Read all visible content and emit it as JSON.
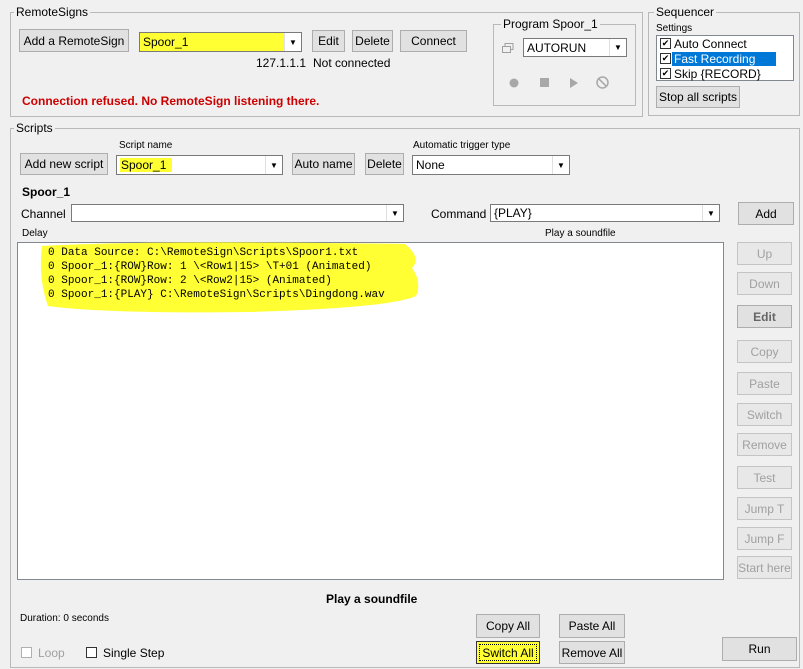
{
  "remote_signs": {
    "group_title": "RemoteSigns",
    "add_button": "Add a RemoteSign",
    "selected_sign": "Spoor_1",
    "edit_button": "Edit",
    "delete_button": "Delete",
    "connect_button": "Connect",
    "address": "127.1.1.1",
    "connection_state": "Not connected",
    "error_message": "Connection refused. No RemoteSign listening there."
  },
  "program": {
    "group_title": "Program Spoor_1",
    "mode": "AUTORUN"
  },
  "sequencer": {
    "group_title": "Sequencer",
    "settings_label": "Settings",
    "options": [
      {
        "label": "Auto Connect",
        "checked": true
      },
      {
        "label": "Fast Recording",
        "checked": true
      },
      {
        "label": "Skip {RECORD}",
        "checked": true
      }
    ],
    "stop_all_button": "Stop all scripts"
  },
  "scripts": {
    "group_title": "Scripts",
    "add_new_button": "Add new script",
    "script_name_label": "Script name",
    "script_name": "Spoor_1",
    "auto_name_button": "Auto name",
    "delete_button": "Delete",
    "trigger_label": "Automatic trigger type",
    "trigger_value": "None",
    "current_script": "Spoor_1",
    "channel_label": "Channel",
    "channel_value": "",
    "command_label": "Command",
    "command_value": "{PLAY}",
    "add_button": "Add",
    "delay_label": "Delay",
    "command_hint": "Play a soundfile",
    "lines": [
      {
        "delay": "0",
        "text": "Data Source: C:\\RemoteSign\\Scripts\\Spoor1.txt"
      },
      {
        "delay": "0",
        "text": "Spoor_1:{ROW}Row: 1 \\<Row1|15> \\T+01 (Animated)"
      },
      {
        "delay": "0",
        "text": "Spoor_1:{ROW}Row: 2 \\<Row2|15> (Animated)"
      },
      {
        "delay": "0",
        "text": "Spoor_1:{PLAY} C:\\RemoteSign\\Scripts\\Dingdong.wav"
      }
    ],
    "side_buttons": {
      "up": "Up",
      "down": "Down",
      "edit": "Edit",
      "copy": "Copy",
      "paste": "Paste",
      "switch": "Switch",
      "remove": "Remove",
      "test": "Test",
      "jump_t": "Jump T",
      "jump_f": "Jump F",
      "start_here": "Start here"
    },
    "description": "Play a soundfile",
    "duration": "Duration: 0 seconds",
    "copy_all_button": "Copy All",
    "paste_all_button": "Paste All",
    "switch_all_button": "Switch All",
    "remove_all_button": "Remove All",
    "loop_label": "Loop",
    "single_step_label": "Single Step",
    "run_button": "Run"
  },
  "colors": {
    "highlight": "#ffff33",
    "error": "#cc0000",
    "selection": "#0078d7"
  }
}
